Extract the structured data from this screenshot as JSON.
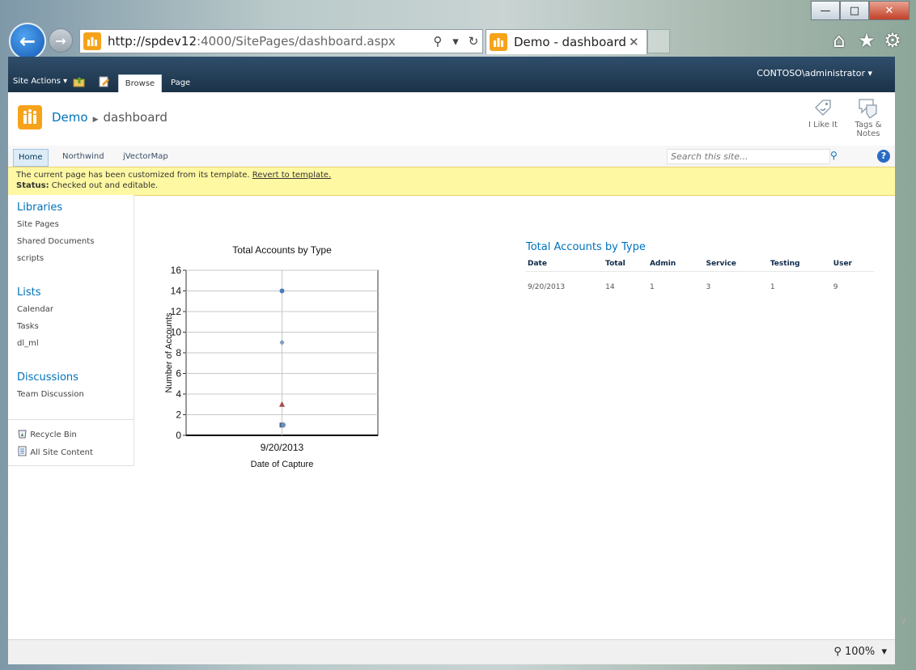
{
  "browser": {
    "url_host": "http://spdev12",
    "url_path": ":4000/SitePages/dashboard.aspx",
    "tab_title": "Demo - dashboard",
    "zoom": "100%"
  },
  "ribbon": {
    "site_actions": "Site Actions",
    "tab_browse": "Browse",
    "tab_page": "Page",
    "user": "CONTOSO\\administrator"
  },
  "header": {
    "site_name": "Demo",
    "page_name": "dashboard",
    "like_label": "I Like It",
    "tags_label_1": "Tags &",
    "tags_label_2": "Notes"
  },
  "topnav": {
    "items": [
      "Home",
      "Northwind",
      "jVectorMap"
    ],
    "search_placeholder": "Search this site..."
  },
  "status": {
    "message": "The current page has been customized from its template.",
    "revert_link": "Revert to template.",
    "status_label": "Status:",
    "status_text": "Checked out and editable."
  },
  "quicklaunch": {
    "libraries": {
      "heading": "Libraries",
      "items": [
        "Site Pages",
        "Shared Documents",
        "scripts"
      ]
    },
    "lists": {
      "heading": "Lists",
      "items": [
        "Calendar",
        "Tasks",
        "dl_ml"
      ]
    },
    "discussions": {
      "heading": "Discussions",
      "items": [
        "Team Discussion"
      ]
    },
    "recycle_bin": "Recycle Bin",
    "all_site_content": "All Site Content"
  },
  "chart_data": {
    "type": "scatter",
    "title": "Total Accounts by Type",
    "xlabel": "Date of Capture",
    "ylabel": "Number of Accounts",
    "categories": [
      "9/20/2013"
    ],
    "ylim": [
      0,
      16
    ],
    "yticks": [
      0,
      2,
      4,
      6,
      8,
      10,
      12,
      14,
      16
    ],
    "grid": true,
    "series": [
      {
        "values": [
          14
        ],
        "color": "#4a7ebb",
        "marker": "circle"
      },
      {
        "values": [
          9
        ],
        "color": "#7f9bb8",
        "marker": "diamond"
      },
      {
        "values": [
          3
        ],
        "color": "#a94a4a",
        "marker": "triangle"
      },
      {
        "values": [
          1
        ],
        "color": "#4a5e7a",
        "marker": "square"
      },
      {
        "values": [
          1
        ],
        "color": "#6b8fbf",
        "marker": "circle"
      }
    ]
  },
  "table": {
    "title": "Total Accounts by Type",
    "columns": [
      "Date",
      "Total",
      "Admin",
      "Service",
      "Testing",
      "User"
    ],
    "rows": [
      [
        "9/20/2013",
        "14",
        "1",
        "3",
        "1",
        "9"
      ]
    ]
  }
}
